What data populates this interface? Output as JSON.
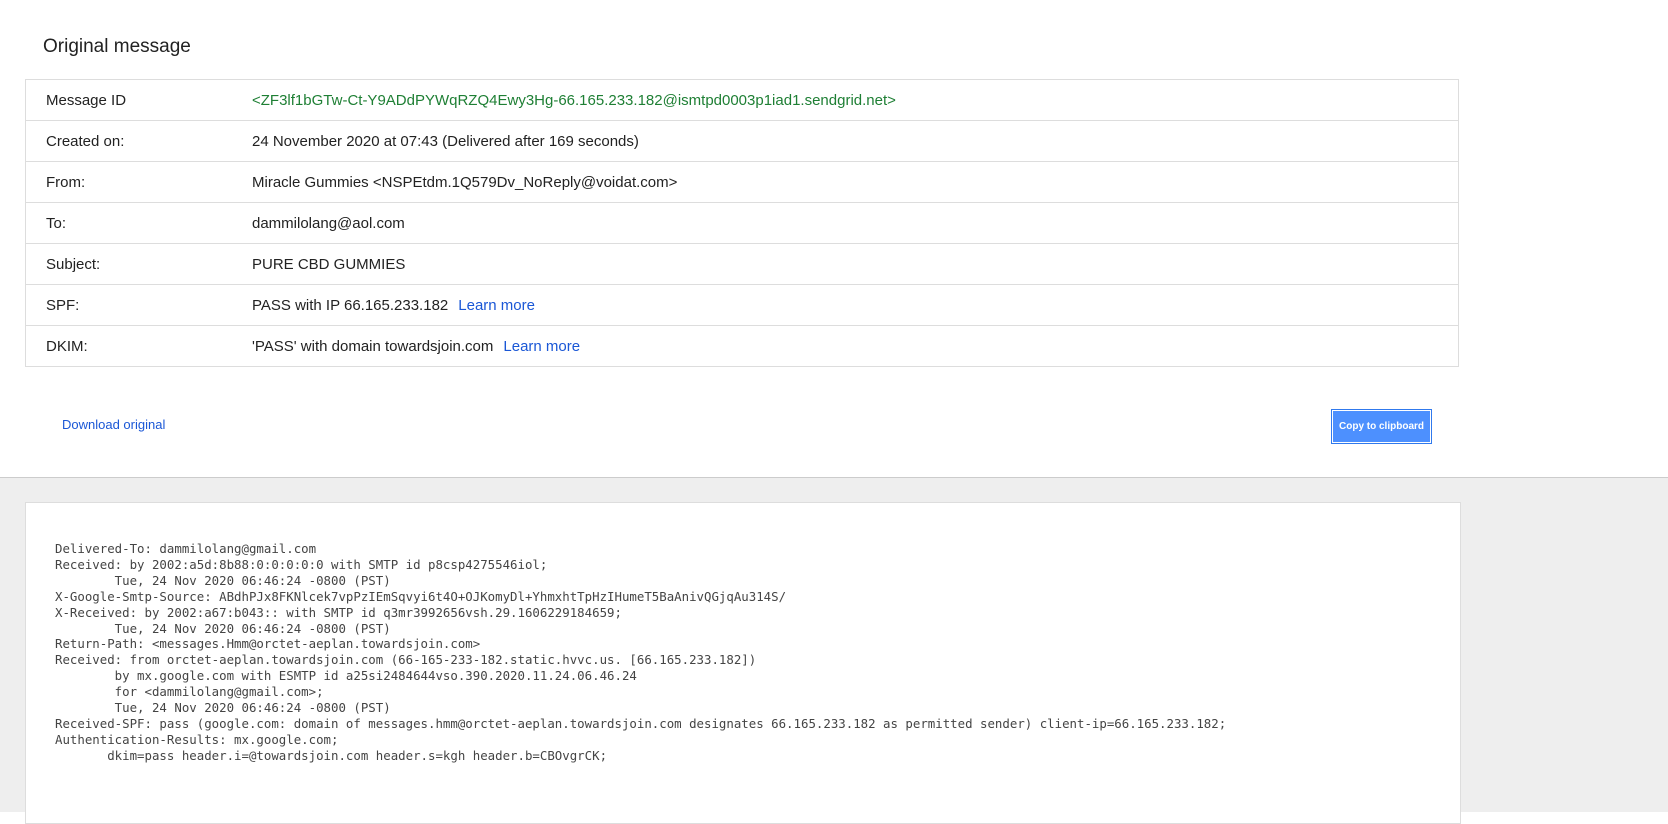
{
  "title": "Original message",
  "rows": [
    {
      "label": "Message ID",
      "value": "<ZF3lf1bGTw-Ct-Y9ADdPYWqRZQ4Ewy3Hg-66.165.233.182@ismtpd0003p1iad1.sendgrid.net>"
    },
    {
      "label": "Created on:",
      "value": "24 November 2020 at 07:43 (Delivered after 169 seconds)"
    },
    {
      "label": "From:",
      "value": "Miracle Gummies <NSPEtdm.1Q579Dv_NoReply@voidat.com>"
    },
    {
      "label": "To:",
      "value": "dammilolang@aol.com"
    },
    {
      "label": "Subject:",
      "value": "PURE CBD GUMMIES"
    },
    {
      "label": "SPF:",
      "value": "PASS with IP 66.165.233.182",
      "link": "Learn more"
    },
    {
      "label": "DKIM:",
      "value": "'PASS' with domain towardsjoin.com",
      "link": "Learn more"
    }
  ],
  "download_label": "Download original",
  "copy_label": "Copy to clipboard",
  "raw": "Delivered-To: dammilolang@gmail.com\nReceived: by 2002:a5d:8b88:0:0:0:0:0 with SMTP id p8csp4275546iol;\n        Tue, 24 Nov 2020 06:46:24 -0800 (PST)\nX-Google-Smtp-Source: ABdhPJx8FKNlcek7vpPzIEmSqvyi6t4O+OJKomyDl+YhmxhtTpHzIHumeT5BaAnivQGjqAu314S/\nX-Received: by 2002:a67:b043:: with SMTP id q3mr3992656vsh.29.1606229184659;\n        Tue, 24 Nov 2020 06:46:24 -0800 (PST)\nReturn-Path: <messages.Hmm@orctet-aeplan.towardsjoin.com>\nReceived: from orctet-aeplan.towardsjoin.com (66-165-233-182.static.hvvc.us. [66.165.233.182])\n        by mx.google.com with ESMTP id a25si2484644vso.390.2020.11.24.06.46.24\n        for <dammilolang@gmail.com>;\n        Tue, 24 Nov 2020 06:46:24 -0800 (PST)\nReceived-SPF: pass (google.com: domain of messages.hmm@orctet-aeplan.towardsjoin.com designates 66.165.233.182 as permitted sender) client-ip=66.165.233.182;\nAuthentication-Results: mx.google.com;\n       dkim=pass header.i=@towardsjoin.com header.s=kgh header.b=CBOvgrCK;"
}
